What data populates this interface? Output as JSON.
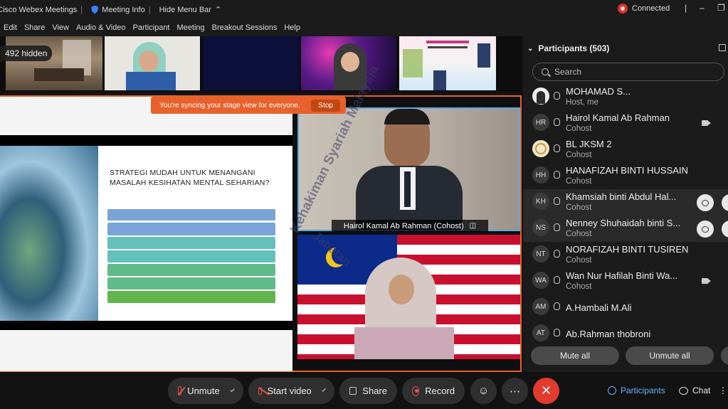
{
  "titlebar": {
    "app_name": "Cisco Webex Meetings",
    "meeting_info": "Meeting Info",
    "hide_menu": "Hide Menu Bar",
    "connection": "Connected"
  },
  "menu": [
    "Edit",
    "Share",
    "View",
    "Audio & Video",
    "Participant",
    "Meeting",
    "Breakout Sessions",
    "Help"
  ],
  "strip": {
    "hidden_count": "492 hidden"
  },
  "sync_banner": {
    "text": "You're syncing your stage view for everyone.",
    "stop": "Stop"
  },
  "slide": {
    "title": "STRATEGI MUDAH UNTUK MENANGANI MASALAH KESIHATAN MENTAL SEHARIAN?"
  },
  "stage_video": {
    "presenter_label": "Hairol Kamal Ab Rahman (Cohost)"
  },
  "watermark": "Kehakiman Syariah Malaysia",
  "watermark2": "Jabatan",
  "participants": {
    "header": "Participants (503)",
    "search_placeholder": "Search",
    "list": [
      {
        "initials": "",
        "name": "MOHAMAD S...",
        "role": "Host, me",
        "camera": false,
        "highlight": false
      },
      {
        "initials": "HR",
        "name": "Hairol Kamal Ab Rahman",
        "role": "Cohost",
        "camera": true,
        "highlight": false
      },
      {
        "initials": "",
        "name": "BL JKSM 2",
        "role": "Cohost",
        "camera": false,
        "highlight": false
      },
      {
        "initials": "HH",
        "name": "HANAFIZAH BINTI HUSSAIN",
        "role": "Cohost",
        "camera": false,
        "highlight": false
      },
      {
        "initials": "KH",
        "name": "Khamsiah binti Abdul Hal...",
        "role": "Cohost",
        "camera": false,
        "highlight": true
      },
      {
        "initials": "NS",
        "name": "Nenney Shuhaidah binti S...",
        "role": "Cohost",
        "camera": false,
        "highlight": true
      },
      {
        "initials": "NT",
        "name": "NORAFIZAH BINTI TUSIREN",
        "role": "Cohost",
        "camera": false,
        "highlight": false
      },
      {
        "initials": "WA",
        "name": "Wan Nur Hafilah Binti Wa...",
        "role": "Cohost",
        "camera": true,
        "highlight": false
      },
      {
        "initials": "AM",
        "name": "A.Hambali M.Ali",
        "role": "",
        "camera": false,
        "highlight": false
      },
      {
        "initials": "AT",
        "name": "Ab.Rahman thobroni",
        "role": "",
        "camera": false,
        "highlight": false
      }
    ],
    "mute_all": "Mute all",
    "unmute_all": "Unmute all"
  },
  "controls": {
    "unmute": "Unmute",
    "start_video": "Start video",
    "share": "Share",
    "record": "Record",
    "participants_tab": "Participants",
    "chat_tab": "Chat"
  },
  "colors": {
    "accent_orange": "#e8612c",
    "end_red": "#e23b2e",
    "active_blue": "#6ab0ff"
  }
}
